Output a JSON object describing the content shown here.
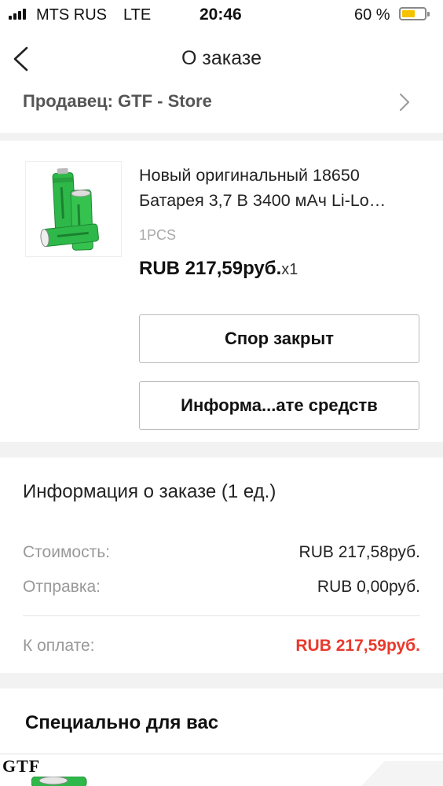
{
  "status_bar": {
    "carrier": "MTS RUS",
    "network": "LTE",
    "time": "20:46",
    "battery_percent": "60 %",
    "battery_level": 0.6,
    "colors": {
      "battery_fill": "#f5c200"
    }
  },
  "nav": {
    "back_icon": "chevron-left-icon",
    "title": "О заказе"
  },
  "seller": {
    "label": "Продавец: GTF - Store",
    "chevron_icon": "chevron-right-icon"
  },
  "product": {
    "image_icon": "battery-product-image",
    "title": "Новый оригинальный 18650 Батарея 3,7 В 3400 мАч Li-Lo…",
    "variant": "1PCS",
    "price": "RUB 217,59руб.",
    "quantity": "x1"
  },
  "actions": {
    "dispute_label": "Спор закрыт",
    "refund_info_label": "Информа...ате средств"
  },
  "order_info": {
    "title": "Информация о заказе (1 ед.)",
    "rows": [
      {
        "label": "Стоимость:",
        "value": "RUB 217,58руб."
      },
      {
        "label": "Отправка:",
        "value": "RUB 0,00руб."
      }
    ],
    "total": {
      "label": "К оплате:",
      "value": "RUB 217,59руб."
    },
    "colors": {
      "total": "#e8392b"
    }
  },
  "recommendations": {
    "title": "Специально для вас",
    "first_item_brand": "GTF"
  }
}
